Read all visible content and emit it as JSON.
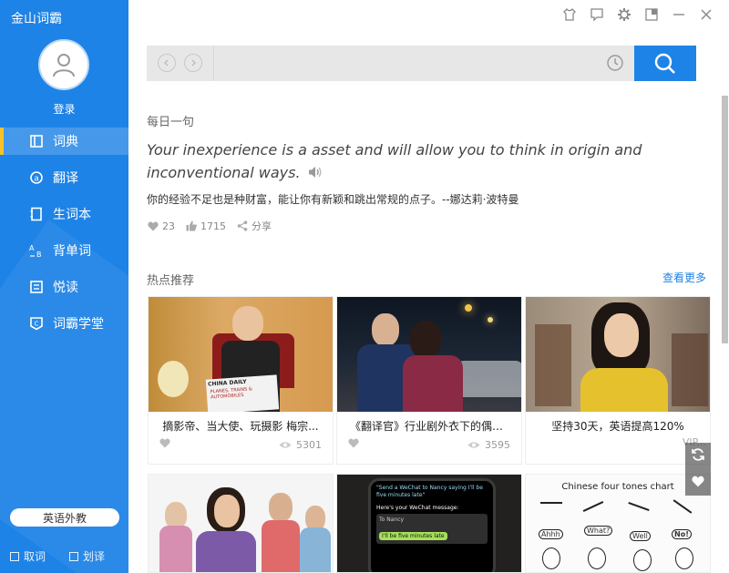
{
  "app": {
    "title": "金山词霸"
  },
  "sidebar": {
    "login": "登录",
    "items": [
      {
        "label": "词典",
        "icon": "book-icon",
        "active": true
      },
      {
        "label": "翻译",
        "icon": "translate-icon"
      },
      {
        "label": "生词本",
        "icon": "notebook-icon"
      },
      {
        "label": "背单词",
        "icon": "memorize-icon"
      },
      {
        "label": "悦读",
        "icon": "reading-icon"
      },
      {
        "label": "词霸学堂",
        "icon": "classroom-icon"
      }
    ],
    "foreign_teacher_button": "英语外教",
    "copy_word": "取词",
    "select_translate": "划译"
  },
  "window_controls": [
    "skin-icon",
    "feedback-icon",
    "settings-icon",
    "mini-mode-icon",
    "minimize-icon",
    "close-icon"
  ],
  "search": {
    "value": "",
    "placeholder": ""
  },
  "daily": {
    "label": "每日一句",
    "sentence_en": "Your inexperience is a asset and will allow you to think in origin and inconventional ways.",
    "sentence_cn": "你的经验不足也是种财富，能让你有新颖和跳出常规的点子。--娜达莉·波特曼",
    "likes": "23",
    "thumbs": "1715",
    "share": "分享"
  },
  "hot": {
    "label": "热点推荐",
    "more": "查看更多",
    "cards": [
      {
        "title": "摘影帝、当大使、玩摄影 梅宗...",
        "views": "5301"
      },
      {
        "title": "《翻译官》行业剧外衣下的偶像剧",
        "views": "3595"
      },
      {
        "title": "坚持30天，英语提高120%",
        "views": ""
      }
    ],
    "image_texts": {
      "newspaper_head": "CHINA DAILY",
      "newspaper_line": "PLANES, TRAINS & AUTOMOBILES",
      "phone_line1": "\"Send a WeChat to Nancy saying I'll be five minutes late\"",
      "phone_line2": "Here's your WeChat message:",
      "phone_to": "To Nancy",
      "phone_msg": "I'll be five minutes late",
      "tones_title": "Chinese four tones chart",
      "tone1": "Ahhh",
      "tone2": "What?",
      "tone3": "Well",
      "tone4": "No!",
      "corner_text": "VIP..."
    }
  },
  "colors": {
    "brand": "#1e83e6",
    "active_marker": "#f5c22a"
  }
}
